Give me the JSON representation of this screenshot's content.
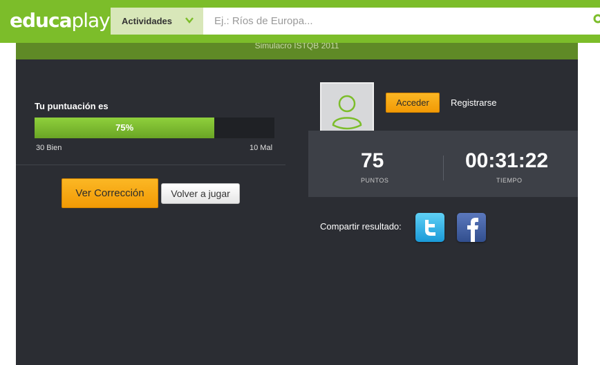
{
  "header": {
    "logo_bold": "educa",
    "logo_light": "play",
    "activities_label": "Actividades",
    "search_placeholder": "Ej.: Ríos de Europa..."
  },
  "quiz": {
    "subtitle": "Simulacro ISTQB 2011"
  },
  "result": {
    "score_label": "Tu puntuación es",
    "percent_text": "75%",
    "percent": 75,
    "good_text": "30 Bien",
    "bad_text": "10 Mal",
    "review_button": "Ver Corrección",
    "replay_button": "Volver a jugar"
  },
  "account": {
    "login_button": "Acceder",
    "register_link": "Registrarse"
  },
  "stats": {
    "points_value": "75",
    "points_label": "PUNTOS",
    "time_value": "00:31:22",
    "time_label": "TIEMPO"
  },
  "share": {
    "label": "Compartir resultado:"
  },
  "colors": {
    "brand_green": "#7cbd2a",
    "accent_orange": "#f29a05",
    "panel_bg": "#2b2d33"
  }
}
